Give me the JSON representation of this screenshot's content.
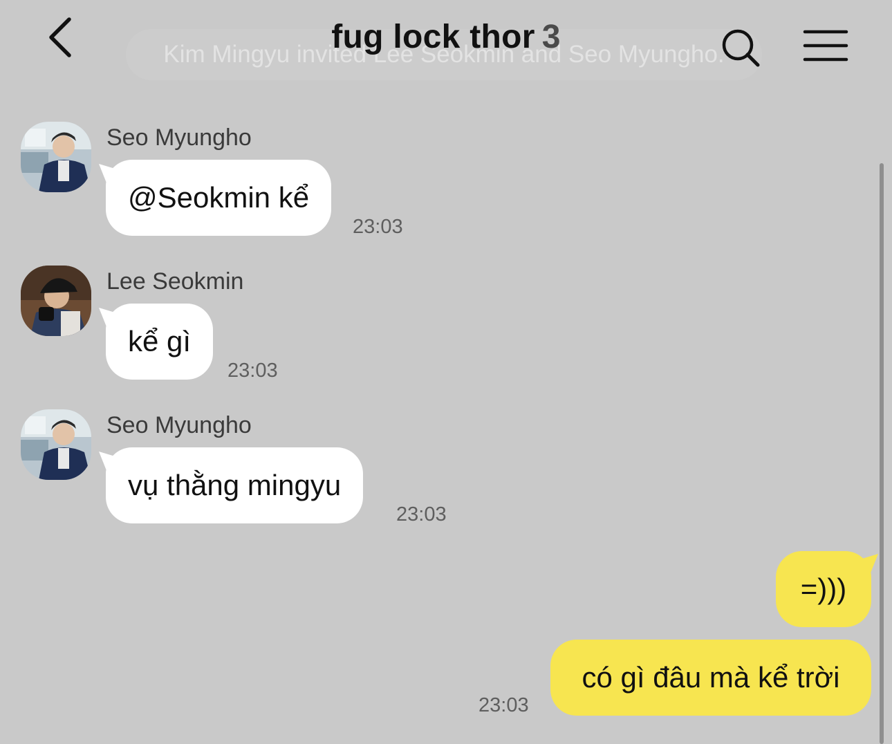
{
  "header": {
    "back_label": "<",
    "title": "fug lock thor",
    "member_count": "3",
    "notice": "Kim Mingyu invited Lee Seokmin and Seo Myungho."
  },
  "messages": [
    {
      "sender": "Seo Myungho",
      "text": "@Seokmin kể",
      "time": "23:03",
      "side": "left"
    },
    {
      "sender": "Lee Seokmin",
      "text": "kể gì",
      "time": "23:03",
      "side": "left"
    },
    {
      "sender": "Seo Myungho",
      "text": "vụ thằng mingyu",
      "time": "23:03",
      "side": "left"
    },
    {
      "text": "=)))",
      "side": "right"
    },
    {
      "text": "có gì đâu mà kể trời",
      "time": "23:03",
      "side": "right"
    }
  ],
  "colors": {
    "background": "#c9c9c9",
    "my_bubble": "#f7e550",
    "their_bubble": "#ffffff"
  }
}
